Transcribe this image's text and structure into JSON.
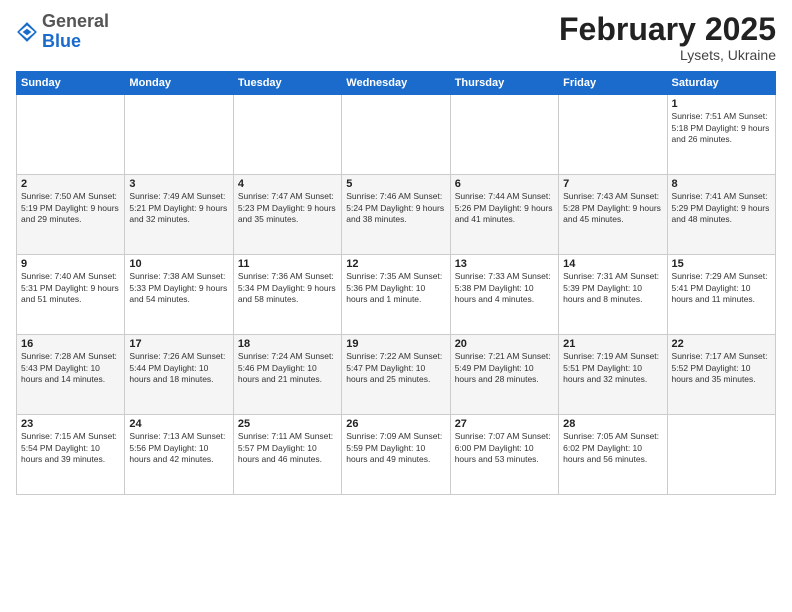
{
  "logo": {
    "general": "General",
    "blue": "Blue"
  },
  "header": {
    "title": "February 2025",
    "subtitle": "Lysets, Ukraine"
  },
  "days_of_week": [
    "Sunday",
    "Monday",
    "Tuesday",
    "Wednesday",
    "Thursday",
    "Friday",
    "Saturday"
  ],
  "weeks": [
    [
      {
        "day": "",
        "info": ""
      },
      {
        "day": "",
        "info": ""
      },
      {
        "day": "",
        "info": ""
      },
      {
        "day": "",
        "info": ""
      },
      {
        "day": "",
        "info": ""
      },
      {
        "day": "",
        "info": ""
      },
      {
        "day": "1",
        "info": "Sunrise: 7:51 AM\nSunset: 5:18 PM\nDaylight: 9 hours and 26 minutes."
      }
    ],
    [
      {
        "day": "2",
        "info": "Sunrise: 7:50 AM\nSunset: 5:19 PM\nDaylight: 9 hours and 29 minutes."
      },
      {
        "day": "3",
        "info": "Sunrise: 7:49 AM\nSunset: 5:21 PM\nDaylight: 9 hours and 32 minutes."
      },
      {
        "day": "4",
        "info": "Sunrise: 7:47 AM\nSunset: 5:23 PM\nDaylight: 9 hours and 35 minutes."
      },
      {
        "day": "5",
        "info": "Sunrise: 7:46 AM\nSunset: 5:24 PM\nDaylight: 9 hours and 38 minutes."
      },
      {
        "day": "6",
        "info": "Sunrise: 7:44 AM\nSunset: 5:26 PM\nDaylight: 9 hours and 41 minutes."
      },
      {
        "day": "7",
        "info": "Sunrise: 7:43 AM\nSunset: 5:28 PM\nDaylight: 9 hours and 45 minutes."
      },
      {
        "day": "8",
        "info": "Sunrise: 7:41 AM\nSunset: 5:29 PM\nDaylight: 9 hours and 48 minutes."
      }
    ],
    [
      {
        "day": "9",
        "info": "Sunrise: 7:40 AM\nSunset: 5:31 PM\nDaylight: 9 hours and 51 minutes."
      },
      {
        "day": "10",
        "info": "Sunrise: 7:38 AM\nSunset: 5:33 PM\nDaylight: 9 hours and 54 minutes."
      },
      {
        "day": "11",
        "info": "Sunrise: 7:36 AM\nSunset: 5:34 PM\nDaylight: 9 hours and 58 minutes."
      },
      {
        "day": "12",
        "info": "Sunrise: 7:35 AM\nSunset: 5:36 PM\nDaylight: 10 hours and 1 minute."
      },
      {
        "day": "13",
        "info": "Sunrise: 7:33 AM\nSunset: 5:38 PM\nDaylight: 10 hours and 4 minutes."
      },
      {
        "day": "14",
        "info": "Sunrise: 7:31 AM\nSunset: 5:39 PM\nDaylight: 10 hours and 8 minutes."
      },
      {
        "day": "15",
        "info": "Sunrise: 7:29 AM\nSunset: 5:41 PM\nDaylight: 10 hours and 11 minutes."
      }
    ],
    [
      {
        "day": "16",
        "info": "Sunrise: 7:28 AM\nSunset: 5:43 PM\nDaylight: 10 hours and 14 minutes."
      },
      {
        "day": "17",
        "info": "Sunrise: 7:26 AM\nSunset: 5:44 PM\nDaylight: 10 hours and 18 minutes."
      },
      {
        "day": "18",
        "info": "Sunrise: 7:24 AM\nSunset: 5:46 PM\nDaylight: 10 hours and 21 minutes."
      },
      {
        "day": "19",
        "info": "Sunrise: 7:22 AM\nSunset: 5:47 PM\nDaylight: 10 hours and 25 minutes."
      },
      {
        "day": "20",
        "info": "Sunrise: 7:21 AM\nSunset: 5:49 PM\nDaylight: 10 hours and 28 minutes."
      },
      {
        "day": "21",
        "info": "Sunrise: 7:19 AM\nSunset: 5:51 PM\nDaylight: 10 hours and 32 minutes."
      },
      {
        "day": "22",
        "info": "Sunrise: 7:17 AM\nSunset: 5:52 PM\nDaylight: 10 hours and 35 minutes."
      }
    ],
    [
      {
        "day": "23",
        "info": "Sunrise: 7:15 AM\nSunset: 5:54 PM\nDaylight: 10 hours and 39 minutes."
      },
      {
        "day": "24",
        "info": "Sunrise: 7:13 AM\nSunset: 5:56 PM\nDaylight: 10 hours and 42 minutes."
      },
      {
        "day": "25",
        "info": "Sunrise: 7:11 AM\nSunset: 5:57 PM\nDaylight: 10 hours and 46 minutes."
      },
      {
        "day": "26",
        "info": "Sunrise: 7:09 AM\nSunset: 5:59 PM\nDaylight: 10 hours and 49 minutes."
      },
      {
        "day": "27",
        "info": "Sunrise: 7:07 AM\nSunset: 6:00 PM\nDaylight: 10 hours and 53 minutes."
      },
      {
        "day": "28",
        "info": "Sunrise: 7:05 AM\nSunset: 6:02 PM\nDaylight: 10 hours and 56 minutes."
      },
      {
        "day": "",
        "info": ""
      }
    ]
  ]
}
